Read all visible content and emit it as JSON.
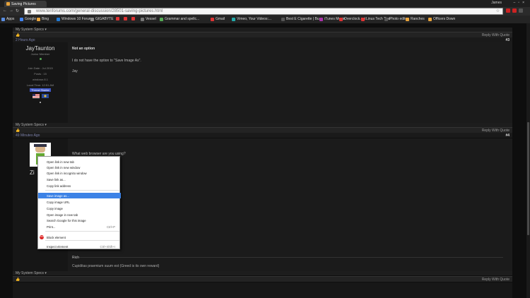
{
  "browser": {
    "tab_title": "Saving Pictures",
    "user": "James",
    "url": "www.tenforums.com/general-discussion/28501-saving-pictures.html",
    "bookmarks": [
      {
        "label": "Apps",
        "color": "#5a8de0"
      },
      {
        "label": "Google",
        "color": "#4285f4"
      },
      {
        "label": "Bing",
        "color": "#e8a33b"
      },
      {
        "label": "Windows 10 Forums",
        "color": "#1f7ad6"
      },
      {
        "label": "GIGABYTE",
        "color": "#888888"
      },
      {
        "label": "",
        "color": "#d33"
      },
      {
        "label": "",
        "color": "#d33"
      },
      {
        "label": "",
        "color": "#d33"
      },
      {
        "label": "Vessel",
        "color": "#777"
      },
      {
        "label": "Grammar and spellc...",
        "color": "#5a5"
      },
      {
        "label": "Gmail",
        "color": "#d33"
      },
      {
        "label": "Vimeo, Your Videos:...",
        "color": "#2aa"
      },
      {
        "label": "Best E Cigarette | Bu...",
        "color": "#555"
      },
      {
        "label": "iTunes Movie",
        "color": "#a3a"
      },
      {
        "label": "Overclock.net",
        "color": "#d33"
      },
      {
        "label": "Linus Tech Tips",
        "color": "#d33"
      },
      {
        "label": "Photo editor",
        "color": "#555"
      },
      {
        "label": "Ranches",
        "color": "#e8a33b"
      },
      {
        "label": "Officers Down",
        "color": "#e8a33b"
      }
    ]
  },
  "page": {
    "top_spec": "My System Specs",
    "top_reply": "Reply With Quote",
    "post3": {
      "date": "2 Hours Ago",
      "number": "#3",
      "user": "JayTaunton",
      "rank": "Junior Member",
      "join": "Join Date : Jul 2015",
      "posts": "Posts : 15",
      "os": "windows 8.1",
      "local_time": "Local Time: 12:51 AM",
      "thread_starter": "Thread Starter",
      "title": "Not an option",
      "body": "I do not have the option to \"Save Image As\".",
      "sig": "Jay",
      "spec": "My System Specs",
      "reply": "Reply With Quote"
    },
    "post4": {
      "date": "49 Minutes Ago",
      "number": "#4",
      "user_partial": "Zi",
      "body": "What web browser are you using?",
      "sig": "Rich",
      "sigline": "Cupiditas praemium suum est (Greed is its own reward)",
      "spec": "My System Specs",
      "reply": "Reply With Quote"
    }
  },
  "context_menu": {
    "items": [
      {
        "label": "Open link in new tab",
        "short": ""
      },
      {
        "label": "Open link in new window",
        "short": ""
      },
      {
        "label": "Open link in incognito window",
        "short": ""
      },
      {
        "label": "Save link as...",
        "short": ""
      },
      {
        "label": "Copy link address",
        "short": ""
      },
      {
        "label": "Save image as...",
        "short": "",
        "highlight": true
      },
      {
        "label": "Copy image URL",
        "short": ""
      },
      {
        "label": "Copy image",
        "short": ""
      },
      {
        "label": "Open image in new tab",
        "short": ""
      },
      {
        "label": "Search Google for this image",
        "short": ""
      },
      {
        "label": "Print...",
        "short": "Ctrl+P"
      },
      {
        "label": "Block element",
        "short": ""
      },
      {
        "label": "Inspect element",
        "short": "Ctrl+Shift+I"
      }
    ]
  }
}
